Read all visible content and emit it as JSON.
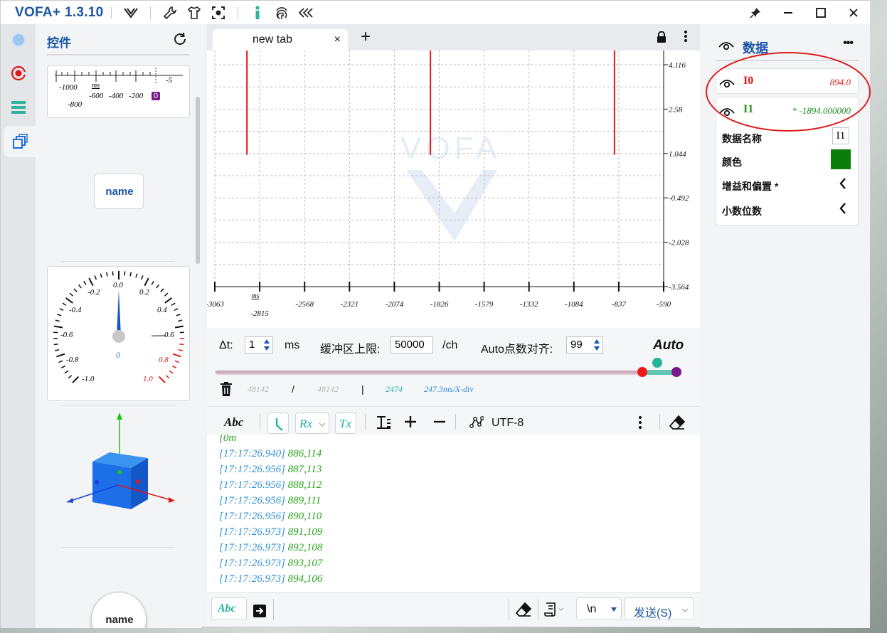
{
  "app": {
    "title": "VOFA+ 1.3.10"
  },
  "widgets": {
    "title": "控件",
    "ruler": {
      "unit": "ms",
      "ticks_top": [
        "-1000",
        "-600",
        "-400",
        "-200",
        "-5"
      ],
      "ticks_bottom": [
        "-800"
      ],
      "badge": "0"
    },
    "button_widget": {
      "label": "name"
    },
    "gauge": {
      "value_label": "0",
      "labels": [
        "-0.2",
        "0.0",
        "0.2",
        "-0.4",
        "0.4",
        "-0.6",
        "0.6",
        "-0.8",
        "0.8",
        "-1.0",
        "1.0"
      ],
      "value": 0
    },
    "round_button": {
      "label": "name"
    }
  },
  "tab": {
    "label": "new tab",
    "close": "×",
    "add": "+"
  },
  "chart_data": {
    "type": "line",
    "title": "",
    "xlabel": "ms",
    "x_ticks": [
      "-3063",
      "-2815",
      "-2568",
      "-2321",
      "-2074",
      "-1826",
      "-1579",
      "-1332",
      "-1084",
      "-837",
      "-590"
    ],
    "y_ticks": [
      "4.116",
      "2.58",
      "1.044",
      "-0.492",
      "-2.028",
      "-3.564"
    ],
    "ylim": [
      -3.564,
      4.116
    ],
    "xlim": [
      -3063,
      -590
    ],
    "grid": true,
    "series": [
      {
        "name": "I0",
        "color": "#e01818",
        "spikes_x": [
          -2886,
          -1875,
          -861
        ],
        "spike_top": 4.5,
        "spike_bottom": 1.0
      }
    ]
  },
  "controls": {
    "dt_label": "Δt:",
    "dt_value": "1",
    "dt_unit": "ms",
    "buffer_label": "缓冲区上限:",
    "buffer_value": "50000",
    "buffer_unit": "/ch",
    "auto_align_label": "Auto点数对齐:",
    "auto_align_value": "99",
    "auto_label": "Auto",
    "stats": {
      "total_a": "48142",
      "sep1": "/",
      "total_b": "48142",
      "sep2": "|",
      "view_points": "2474",
      "scale": "247.3ms/X-div"
    },
    "slider_fraction": 0.99
  },
  "console_toolbar": {
    "abc": "Abc",
    "rx": "Rx",
    "tx": "Tx",
    "encoding": "UTF-8"
  },
  "console": {
    "partial": "[0m",
    "lines": [
      {
        "ts": "[17:17:26.940]",
        "val": "886,114"
      },
      {
        "ts": "[17:17:26.956]",
        "val": "887,113"
      },
      {
        "ts": "[17:17:26.956]",
        "val": "888,112"
      },
      {
        "ts": "[17:17:26.956]",
        "val": "889,111"
      },
      {
        "ts": "[17:17:26.956]",
        "val": "890,110"
      },
      {
        "ts": "[17:17:26.973]",
        "val": "891,109"
      },
      {
        "ts": "[17:17:26.973]",
        "val": "892,108"
      },
      {
        "ts": "[17:17:26.973]",
        "val": "893,107"
      },
      {
        "ts": "[17:17:26.973]",
        "val": "894,106"
      }
    ]
  },
  "send_bar": {
    "abc": "Abc",
    "newline": "\\n",
    "send": "发送(S)"
  },
  "data_panel": {
    "title": "数据",
    "more": "•••",
    "channels": [
      {
        "name": "I0",
        "value": "894.0",
        "color": "#e01818"
      },
      {
        "name": "I1",
        "value": "* -1894.000000",
        "color": "#1f8f1f"
      }
    ],
    "props": {
      "name_label": "数据名称",
      "name_value": "I1",
      "color_label": "颜色",
      "color_value": "#0a7d0a",
      "gain_label": "增益和偏置 *",
      "decimal_label": "小数位数"
    }
  }
}
